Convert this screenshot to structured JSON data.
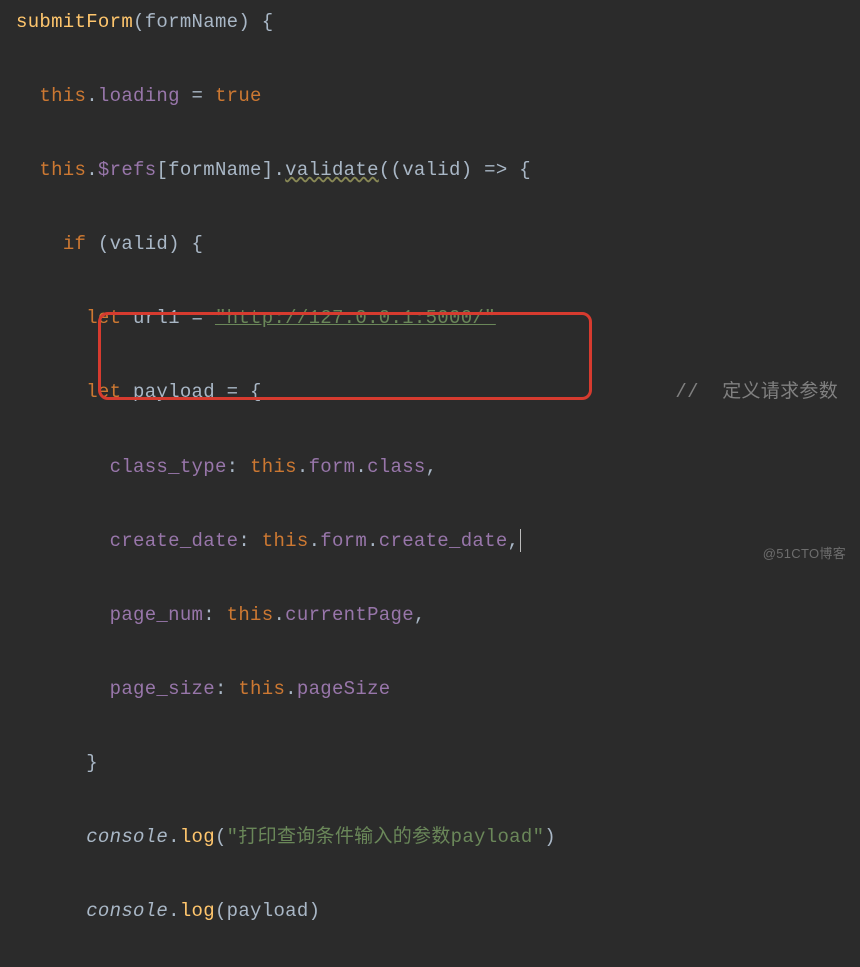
{
  "code": {
    "fn_name": "submitForm",
    "param": "formName",
    "line1_this": "this",
    "line1_loading": "loading",
    "line1_assign": " = ",
    "line1_true": "true",
    "line2_this": "this",
    "line2_refs": "$refs",
    "line2_formName": "formName",
    "line2_validate": "validate",
    "line2_valid": "valid",
    "line2_arrow": " => ",
    "line3_if": "if",
    "line3_valid": "valid",
    "line4_let": "let",
    "line4_url1": "url1",
    "line4_url": "\"http://127.0.0.1:5000/\"",
    "line5_let": "let",
    "line5_payload": "payload",
    "line5_comment": "//  定义请求参数",
    "line6_class_type": "class_type",
    "line6_this": "this",
    "line6_form": "form",
    "line6_class": "class",
    "line7_create_date": "create_date",
    "line7_this": "this",
    "line7_form": "form",
    "line7_cdate": "create_date",
    "line8_page_num": "page_num",
    "line8_this": "this",
    "line8_currentPage": "currentPage",
    "line9_page_size": "page_size",
    "line9_this": "this",
    "line9_pageSize": "pageSize",
    "line11_console": "console",
    "line11_log": "log",
    "line11_str": "\"打印查询条件输入的参数payload\"",
    "line12_console": "console",
    "line12_log": "log",
    "line12_payload": "payload"
  },
  "watermark": "@51CTO博客"
}
